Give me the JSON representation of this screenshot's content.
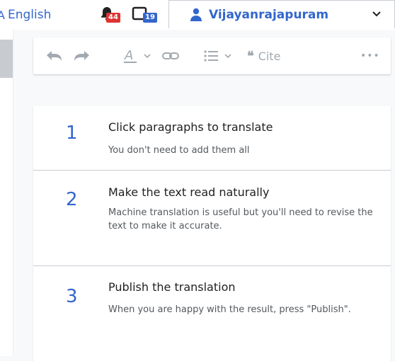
{
  "topbar": {
    "language_label": "English",
    "language_glyph": "文A",
    "alerts_count": "44",
    "notices_count": "19",
    "username": "Vijayanrajapuram"
  },
  "toolbar": {
    "items": [
      "undo-icon",
      "redo-icon",
      "text-style-icon",
      "link-icon",
      "list-icon",
      "cite"
    ],
    "cite_label": "Cite",
    "more_label": "•••"
  },
  "steps": [
    {
      "number": "1",
      "title": "Click paragraphs to translate",
      "description": "You don't need to add them all"
    },
    {
      "number": "2",
      "title": "Make the text read naturally",
      "description": "Machine translation is useful but you'll need to revise the text to make it accurate."
    },
    {
      "number": "3",
      "title": "Publish the translation",
      "description": "When you are happy with the result, press \"Publish\"."
    }
  ]
}
